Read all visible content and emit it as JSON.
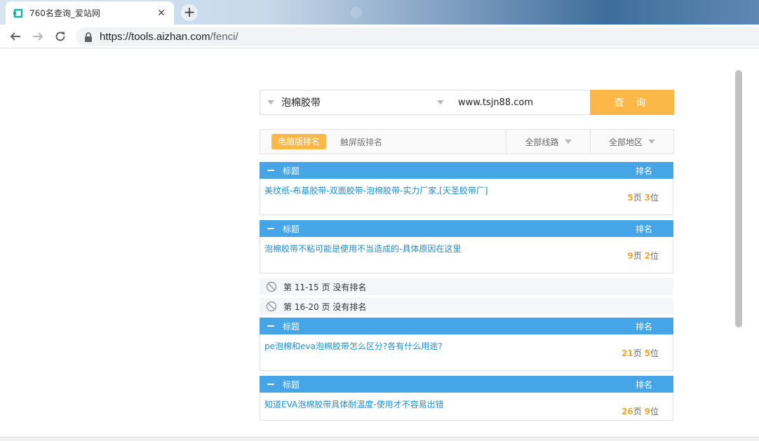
{
  "browser": {
    "tab_title": "760名查询_爱站网",
    "url_host": "https://tools.aizhan.com",
    "url_path": "/fenci/"
  },
  "search": {
    "keyword": "泡棉胶带",
    "site": "www.tsjn88.com",
    "button_label": "查 询"
  },
  "filters": {
    "pc_rank": "电脑版排名",
    "mobile_rank": "触屏版排名",
    "all_routes": "全部线路",
    "all_regions": "全部地区"
  },
  "columns": {
    "title": "标题",
    "rank": "排名"
  },
  "results": [
    {
      "title": "美纹纸-布基胶带-双面胶带-泡棉胶带-实力厂家,[天圣胶带厂]",
      "page": "5",
      "page_unit": "页",
      "pos": "3",
      "pos_unit": "位"
    },
    {
      "title": "泡棉胶带不粘可能是使用不当造成的-具体原因在这里",
      "page": "9",
      "page_unit": "页",
      "pos": "2",
      "pos_unit": "位"
    },
    {
      "title": "pe泡棉和eva泡棉胶带怎么区分?各有什么用途?",
      "page": "21",
      "page_unit": "页",
      "pos": "5",
      "pos_unit": "位"
    },
    {
      "title": "知道EVA泡棉胶带具体耐温度-使用才不容易出错",
      "page": "26",
      "page_unit": "页",
      "pos": "9",
      "pos_unit": "位"
    }
  ],
  "no_rank": [
    "第 11-15 页 没有排名",
    "第 16-20 页 没有排名"
  ],
  "colors": {
    "accent_orange": "#fbb748",
    "header_blue": "#46a5e6",
    "link_blue": "#1a8fd1",
    "rank_number": "#f5a623"
  }
}
